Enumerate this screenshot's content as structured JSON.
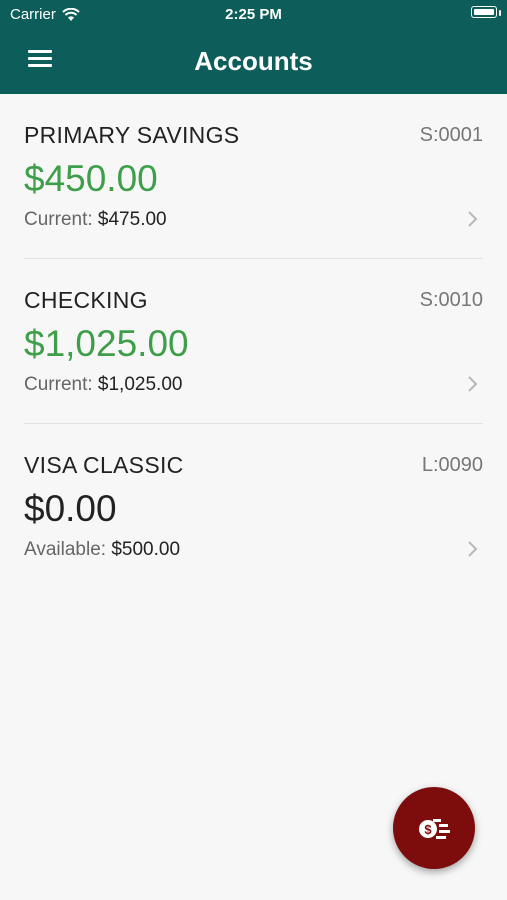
{
  "status": {
    "carrier": "Carrier",
    "time": "2:25 PM"
  },
  "header": {
    "title": "Accounts",
    "menu_icon": "hamburger-menu-icon"
  },
  "accounts": [
    {
      "name": "PRIMARY SAVINGS",
      "code": "S:0001",
      "balance": "$450.00",
      "balance_color": "#3f9e4a",
      "sub_label": "Current:",
      "sub_value": "$475.00"
    },
    {
      "name": "CHECKING",
      "code": "S:0010",
      "balance": "$1,025.00",
      "balance_color": "#3f9e4a",
      "sub_label": "Current:",
      "sub_value": "$1,025.00"
    },
    {
      "name": "VISA CLASSIC",
      "code": "L:0090",
      "balance": "$0.00",
      "balance_color": "#222222",
      "sub_label": "Available:",
      "sub_value": "$500.00"
    }
  ],
  "fab": {
    "icon": "transfer-money-icon",
    "color": "#7d0d0d"
  },
  "colors": {
    "header_bg": "#0d5e5a",
    "positive_balance": "#3f9e4a"
  }
}
